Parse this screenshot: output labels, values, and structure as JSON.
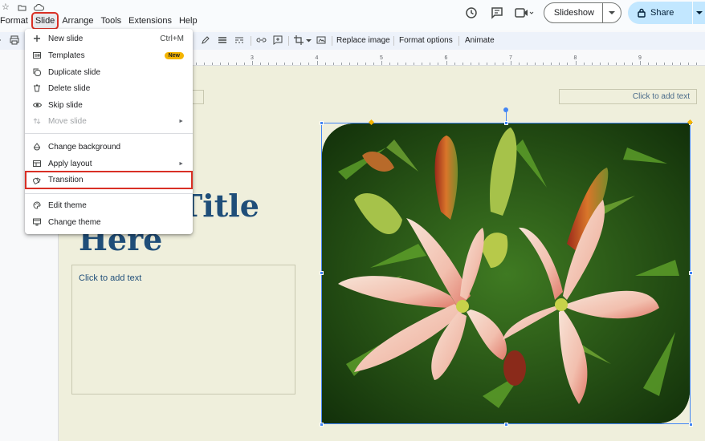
{
  "menubar": {
    "items": [
      "Format",
      "Slide",
      "Arrange",
      "Tools",
      "Extensions",
      "Help"
    ],
    "active": "Slide"
  },
  "header": {
    "slideshow_label": "Slideshow",
    "share_label": "Share"
  },
  "toolbar": {
    "replace_image": "Replace image",
    "format_options": "Format options",
    "animate": "Animate"
  },
  "ruler": {
    "numbers": [
      "3",
      "4",
      "5",
      "6",
      "7",
      "8",
      "9"
    ]
  },
  "slide_menu": {
    "items": [
      {
        "label": "New slide",
        "icon": "plus-icon",
        "shortcut": "Ctrl+M"
      },
      {
        "label": "Templates",
        "icon": "template-icon",
        "badge": "New"
      },
      {
        "label": "Duplicate slide",
        "icon": "duplicate-icon"
      },
      {
        "label": "Delete slide",
        "icon": "trash-icon"
      },
      {
        "label": "Skip slide",
        "icon": "eye-icon"
      },
      {
        "label": "Move slide",
        "icon": "move-icon",
        "disabled": true,
        "submenu": true
      },
      {
        "label": "Change background",
        "icon": "fill-icon"
      },
      {
        "label": "Apply layout",
        "icon": "layout-icon",
        "submenu": true
      },
      {
        "label": "Transition",
        "icon": "transition-icon"
      },
      {
        "label": "Edit theme",
        "icon": "palette-icon"
      },
      {
        "label": "Change theme",
        "icon": "theme-icon"
      }
    ]
  },
  "slide": {
    "title_line1": "Title",
    "title_line2": "Here",
    "body_placeholder": "Click to add text",
    "top_right_placeholder": "Click to add text"
  },
  "colors": {
    "accent_highlight": "#d93025",
    "share_bg": "#c2e7ff",
    "slide_bg": "#efefdc",
    "title_color": "#1f4e79",
    "selection_blue": "#4285f4",
    "badge_yellow": "#f4b400"
  }
}
